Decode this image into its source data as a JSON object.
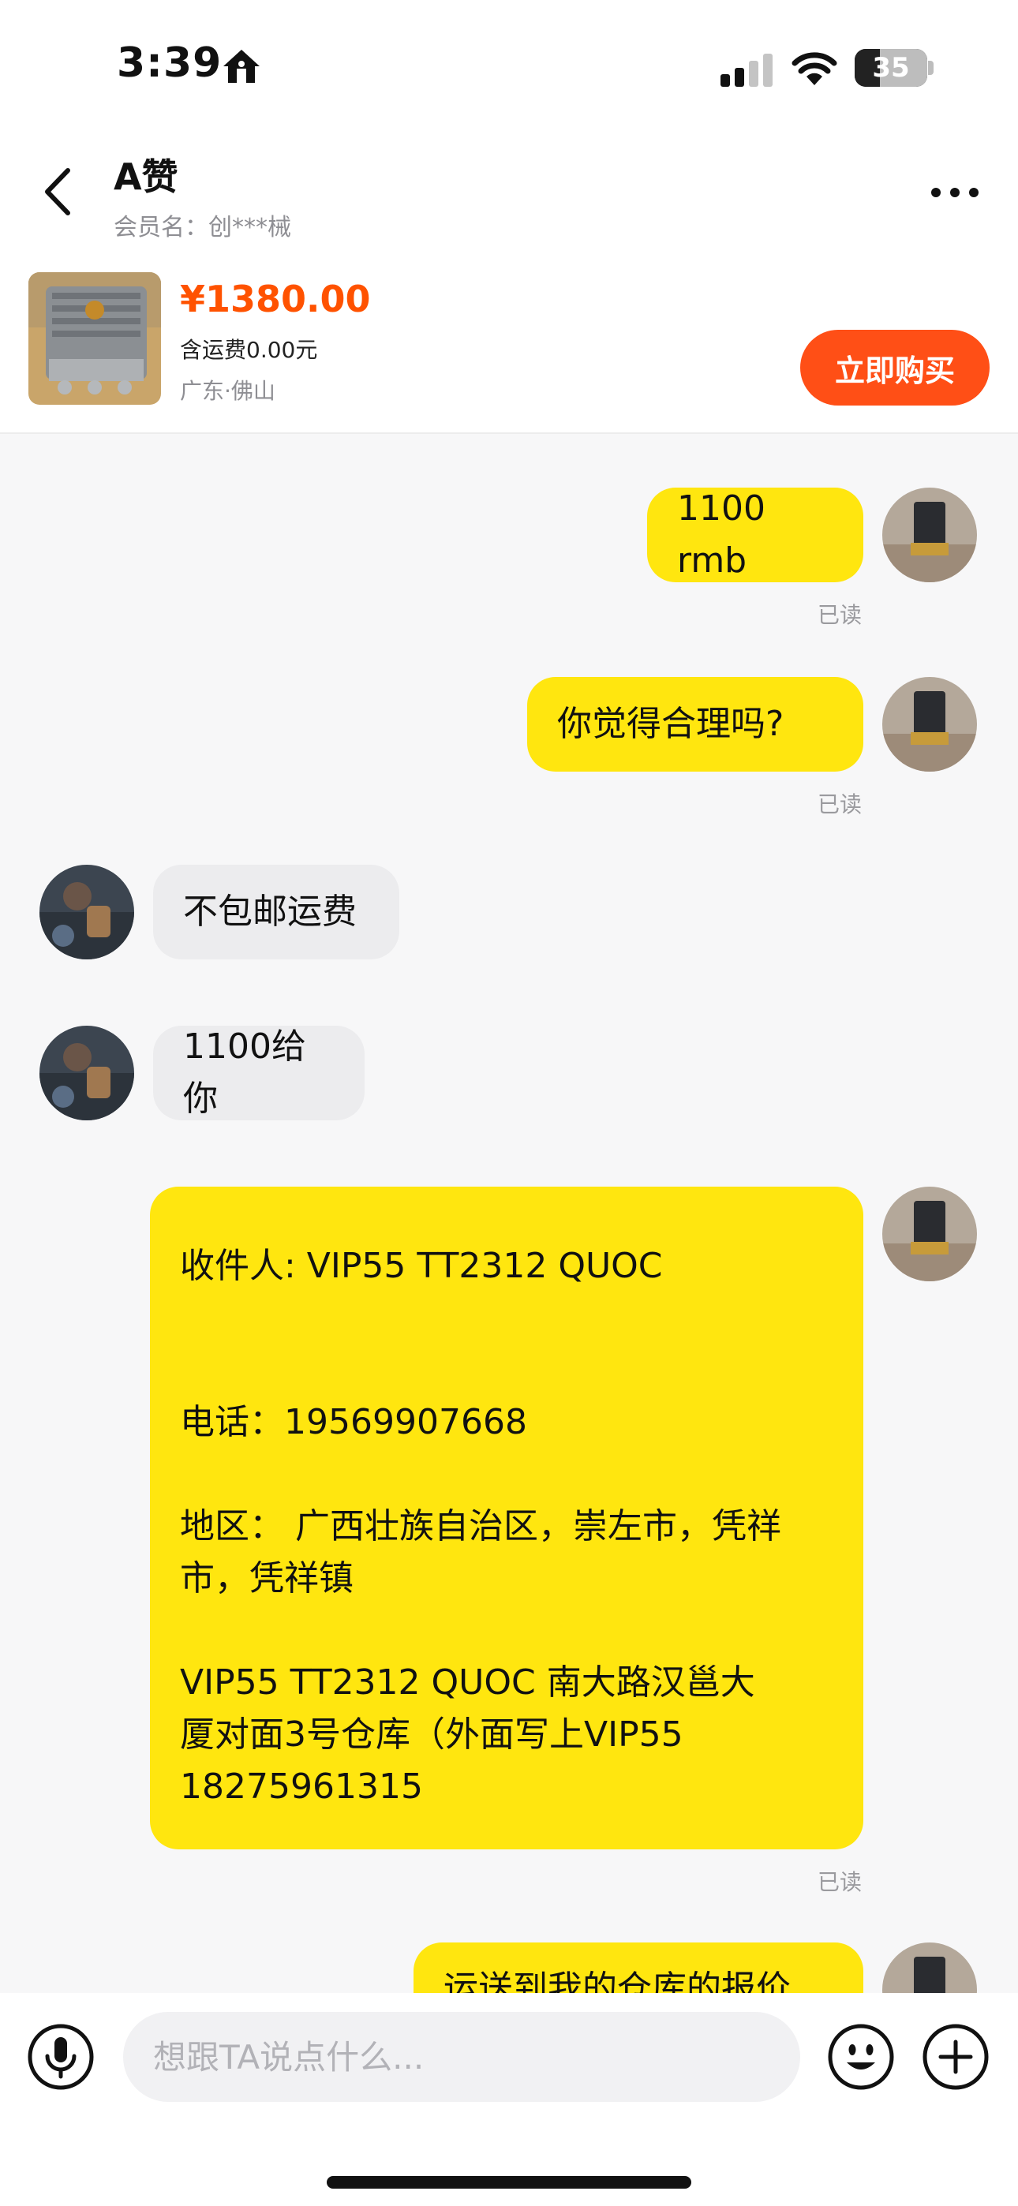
{
  "status_bar": {
    "time": "3:39",
    "battery_level": "35",
    "icons": [
      "home-icon",
      "cellular-signal-icon",
      "wifi-icon",
      "battery-icon"
    ]
  },
  "header": {
    "contact_name": "A赞",
    "member_label": "会员名：创***械",
    "icons": [
      "back-icon",
      "more-icon"
    ]
  },
  "product": {
    "price": "¥1380.00",
    "shipping": "含运费0.00元",
    "location": "广东·佛山",
    "buy_label": "立即购买"
  },
  "messages": [
    {
      "from": "me",
      "text": "1100 rmb",
      "status": "已读"
    },
    {
      "from": "me",
      "text": "你觉得合理吗?",
      "status": "已读"
    },
    {
      "from": "them",
      "text": "不包邮运费"
    },
    {
      "from": "them",
      "text": "1100给你"
    },
    {
      "from": "me",
      "lines": [
        "收件人: VIP55 TT2312 QUOC",
        "电话：19569907668",
        "地区： 广西壮族自治区，崇左市，凭祥",
        "市，凭祥镇",
        "VIP55 TT2312 QUOC  南大路汉邕大",
        "厦对面3号仓库（外面写上VIP55",
        "18275961315"
      ],
      "status": "已读"
    },
    {
      "from": "me",
      "text": "运送到我的仓库的报价"
    }
  ],
  "input_bar": {
    "placeholder": "想跟TA说点什么...",
    "icons": [
      "mic-icon",
      "emoji-icon",
      "plus-icon"
    ]
  },
  "colors": {
    "accent_orange": "#ff4f16",
    "price_orange": "#ff5200",
    "my_bubble": "#ffe60f",
    "their_bubble": "#ececee"
  }
}
